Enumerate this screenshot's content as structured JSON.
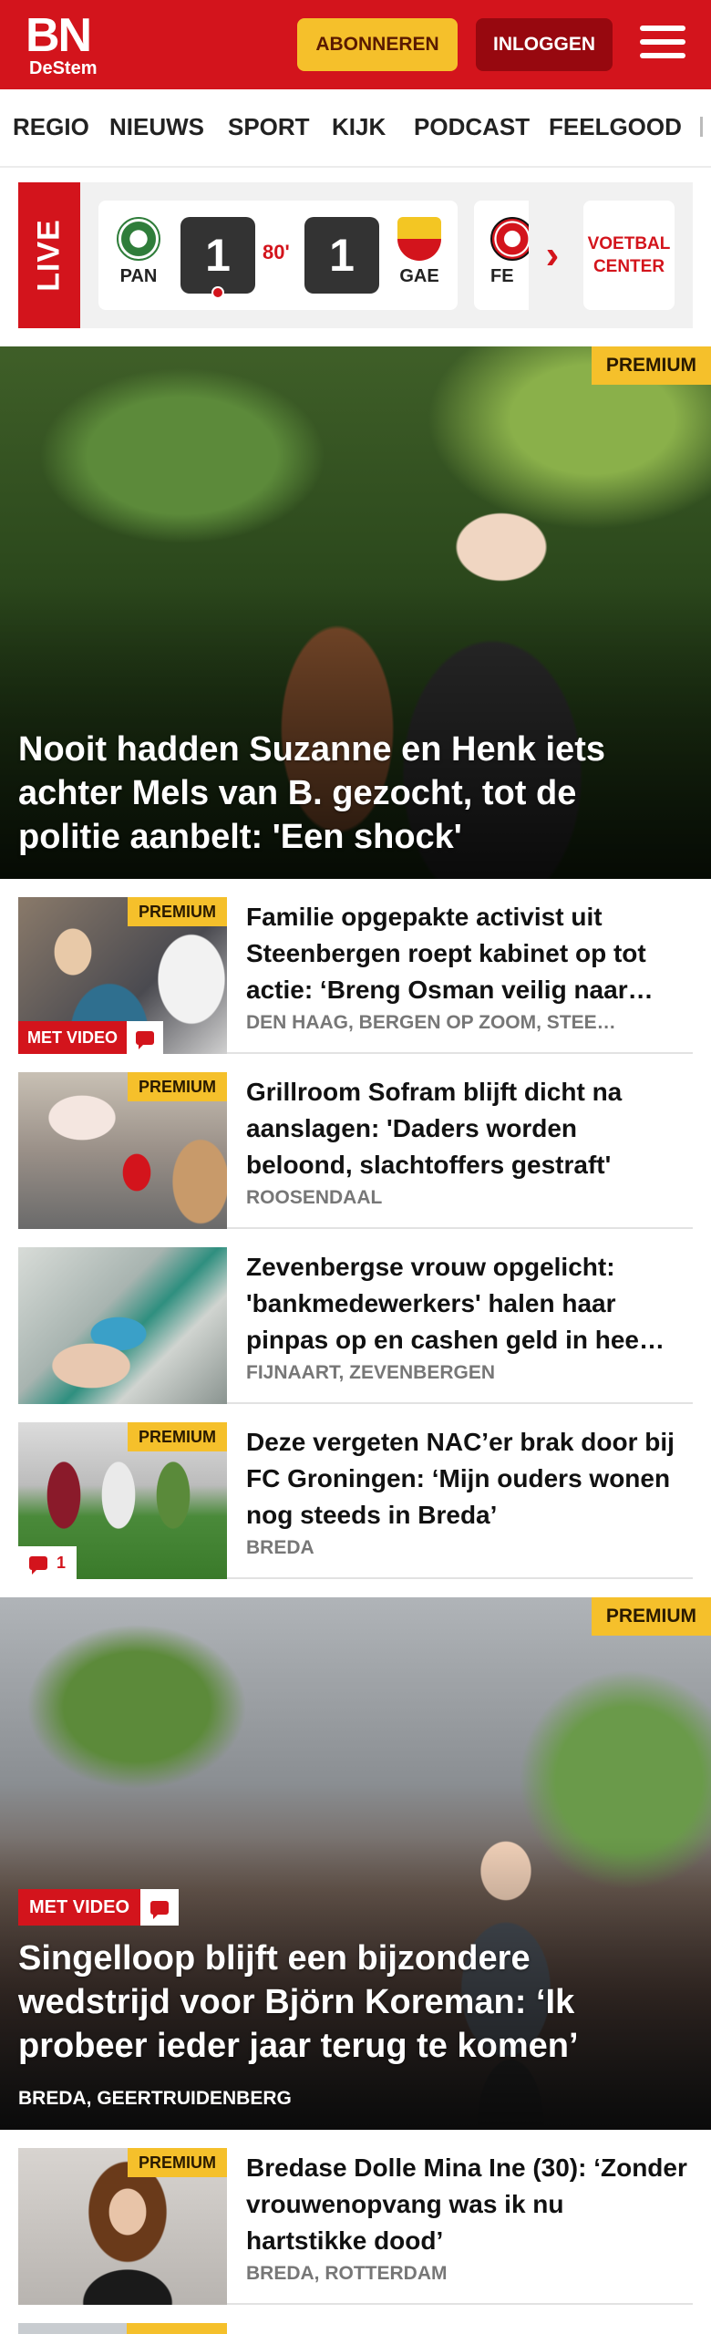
{
  "header": {
    "logo_main": "BN",
    "logo_sub": "DeStem",
    "subscribe_label": "ABONNEREN",
    "login_label": "INLOGGEN"
  },
  "nav": {
    "items": [
      "REGIO",
      "NIEUWS",
      "SPORT",
      "KIJK",
      "PODCAST",
      "FEELGOOD"
    ]
  },
  "live": {
    "label": "LIVE",
    "match": {
      "home": "PAN",
      "away": "GAE",
      "home_score": "1",
      "away_score": "1",
      "minute": "80'"
    },
    "next_match_home": "FE",
    "voetbal_center_label": "VOETBAL CENTER"
  },
  "badges": {
    "premium": "PREMIUM",
    "met_video": "MET VIDEO"
  },
  "articles": [
    {
      "title": "Nooit hadden Suzanne en Henk iets achter Mels van B. gezocht, tot de politie aanbelt: 'Een shock'",
      "premium": true
    },
    {
      "title": "Familie opgepakte activist uit Steenbergen roept kabinet op tot actie: ‘Breng Osman veilig naar…",
      "location": "DEN HAAG, BERGEN OP ZOOM, STEE…",
      "premium": true,
      "met_video": true
    },
    {
      "title": "Grillroom Sofram blijft dicht na aanslagen: 'Daders worden beloond, slachtoffers gestraft'",
      "location": "ROOSENDAAL",
      "premium": true
    },
    {
      "title": "Zevenbergse vrouw opgelicht: 'bankmedewerkers' halen haar pinpas op en cashen geld in hee…",
      "location": "FIJNAART, ZEVENBERGEN",
      "premium": false
    },
    {
      "title": "Deze vergeten NAC’er brak door bij FC Groningen: ‘Mijn ouders wonen nog steeds in Breda’",
      "location": "BREDA",
      "premium": true,
      "comment_count": "1"
    },
    {
      "title": "Singelloop blijft een bijzondere wedstrijd voor Björn Koreman: ‘Ik probeer ieder jaar terug te komen’",
      "location": "BREDA, GEERTRUIDENBERG",
      "premium": true,
      "met_video": true
    },
    {
      "title": "Bredase Dolle Mina Ine (30): ‘Zonder vrouwenopvang was ik nu hartstikke dood’",
      "location": "BREDA, ROTTERDAM",
      "premium": true
    }
  ],
  "colors": {
    "brand_red": "#d3141c",
    "premium_yellow": "#f5c02b",
    "login_dark_red": "#97080f"
  }
}
